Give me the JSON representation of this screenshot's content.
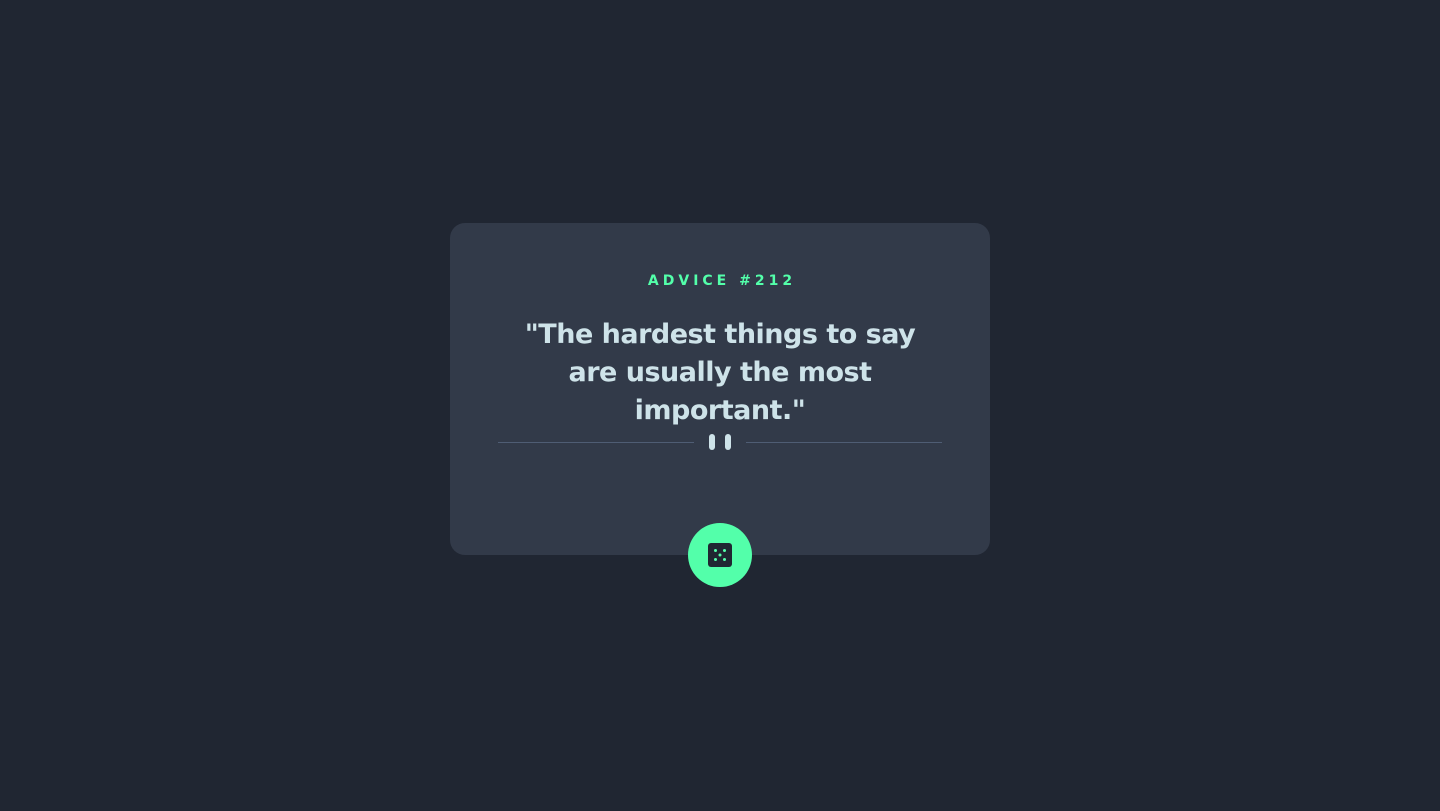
{
  "advice": {
    "id_label": "ADVICE #212",
    "quote": "\"The hardest things to say are usually the most important.\""
  },
  "divider": {
    "icon": "pause-icon"
  },
  "dice_button": {
    "icon": "dice-icon",
    "color": "#53ffaa"
  },
  "colors": {
    "background": "#202632",
    "card": "#323a49",
    "accent": "#53ffaa",
    "text": "#cee3e9",
    "divider_line": "#4f5d74"
  }
}
